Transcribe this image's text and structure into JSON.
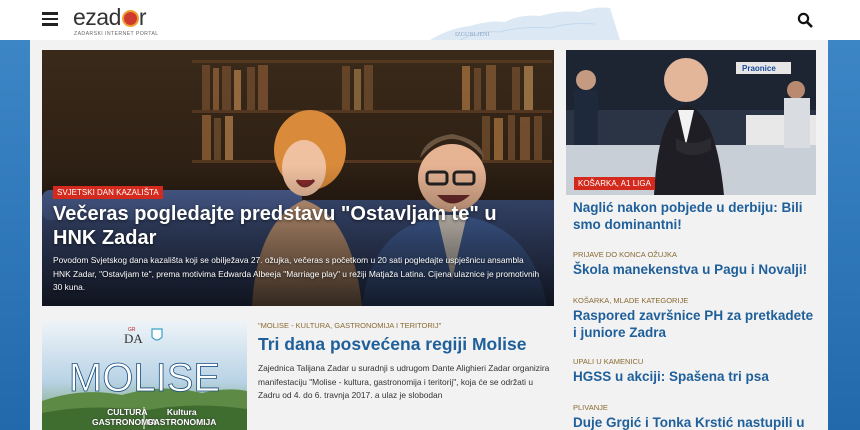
{
  "header": {
    "logo_text": "ezad",
    "logo_text_end": "r",
    "logo_subtitle": "ZADARSKI INTERNET PORTAL",
    "map_label": "IZGUBLJENI"
  },
  "hero": {
    "tag": "Svjetski dan kazališta",
    "title": "Večeras pogledajte predstavu \"Ostavljam te\" u HNK Zadar",
    "text": "Povodom Svjetskog dana kazališta koji se obilježava 27. ožujka, večeras s početkom u 20 sati pogledajte uspješnicu ansambla HNK Zadar, \"Ostavljam te\", prema motivima Edwarda Albeeja \"Marriage play\" u režiji Matjaža Latina. Cijena ulaznice je promotivnih 30 kuna."
  },
  "side_card": {
    "tag": "Košarka, A1 liga",
    "sign_text": "Praonice"
  },
  "side_items": [
    {
      "kicker": "",
      "title": "Naglić nakon pobjede u derbiju: Bili smo dominantni!"
    },
    {
      "kicker": "Prijave do konca ožujka",
      "title": "Škola manekenstva u Pagu i Novalji!"
    },
    {
      "kicker": "Košarka, mlade kategorije",
      "title": "Raspored završnice PH za pretkadete i juniore Zadra"
    },
    {
      "kicker": "Upali u kamenicu",
      "title": "HGSS u akciji: Spašena tri psa"
    },
    {
      "kicker": "Plivanje",
      "title": "Duje Grgić i Tonka Krstić nastupili u"
    }
  ],
  "story2": {
    "kicker": "\"Molise - kultura, gastronomija i teritorij\"",
    "title": "Tri dana posvećena regiji Molise",
    "text": "Zajednica Talijana Zadar u suradnji s udrugom Dante Alighieri Zadar organizira manifestaciju \"Molise - kultura, gastronomija i teritorij\", koja će se održati u Zadru od 4. do 6. travnja 2017. a ulaz je slobodan",
    "image": {
      "badge": "DA",
      "headline": "MOLISE",
      "left_line1": "CULTURA",
      "left_line2": "GASTRONOMIA",
      "right_line1": "Kultura",
      "right_line2": "GASTRONOMIJA"
    }
  },
  "colors": {
    "accent_red": "#d42a1e",
    "link_blue": "#1f5f9a",
    "kicker_brown": "#8a6a33",
    "page_blue": "#2a75b8"
  },
  "icons": [
    "hamburger-menu-icon",
    "search-icon",
    "shield-icon"
  ]
}
